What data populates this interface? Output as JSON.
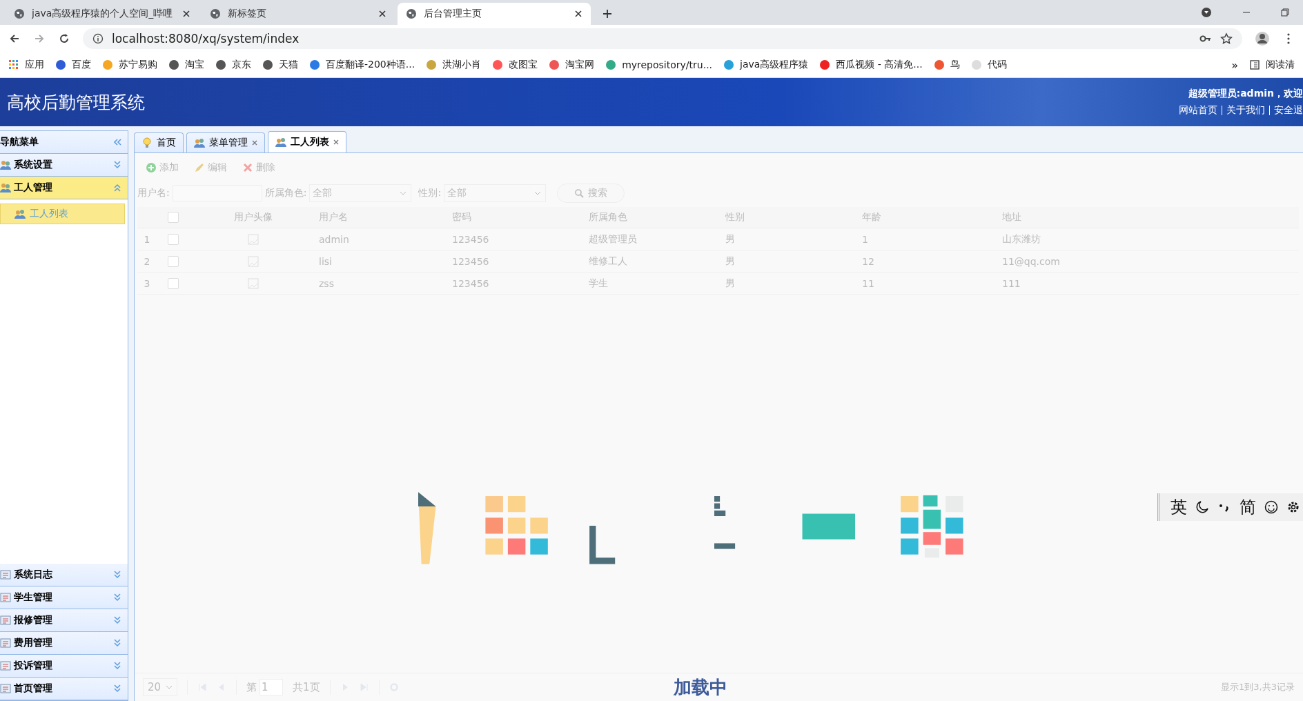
{
  "browser": {
    "tabs": [
      {
        "title": "java高级程序猿的个人空间_哔哩",
        "selected": false
      },
      {
        "title": "新标签页",
        "selected": false
      },
      {
        "title": "后台管理主页",
        "selected": true
      }
    ],
    "url": "localhost:8080/xq/system/index",
    "bookmarks": [
      {
        "label": "应用"
      },
      {
        "label": "百度"
      },
      {
        "label": "苏宁易购"
      },
      {
        "label": "淘宝"
      },
      {
        "label": "京东"
      },
      {
        "label": "天猫"
      },
      {
        "label": "百度翻译-200种语..."
      },
      {
        "label": "洪湖小肖"
      },
      {
        "label": "改图宝"
      },
      {
        "label": "淘宝网"
      },
      {
        "label": "myrepository/tru..."
      },
      {
        "label": "java高级程序猿"
      },
      {
        "label": "西瓜视频 - 高清免..."
      },
      {
        "label": "鸟"
      },
      {
        "label": "代码"
      }
    ],
    "overflow": "»",
    "reading_list": "阅读清"
  },
  "header": {
    "title": "高校后勤管理系统",
    "greeting": "超级管理员:admin，欢迎",
    "links": [
      "网站首页",
      "关于我们",
      "安全退"
    ]
  },
  "sidebar": {
    "title": "导航菜单",
    "sections": [
      {
        "label": "系统设置",
        "expanded": false
      },
      {
        "label": "工人管理",
        "expanded": true,
        "children": [
          {
            "label": "工人列表",
            "selected": true
          }
        ]
      }
    ],
    "bottom_sections": [
      {
        "label": "系统日志",
        "expanded": false
      },
      {
        "label": "学生管理",
        "expanded": false
      },
      {
        "label": "报修管理",
        "expanded": false
      },
      {
        "label": "费用管理",
        "expanded": false
      },
      {
        "label": "投诉管理",
        "expanded": false
      },
      {
        "label": "首页管理",
        "expanded": false
      }
    ]
  },
  "tabs": [
    {
      "label": "首页",
      "selected": false,
      "closable": false
    },
    {
      "label": "菜单管理",
      "selected": false,
      "closable": true
    },
    {
      "label": "工人列表",
      "selected": true,
      "closable": true
    }
  ],
  "toolbar": [
    {
      "label": "添加",
      "kind": "add"
    },
    {
      "label": "编辑",
      "kind": "edit"
    },
    {
      "label": "删除",
      "kind": "delete"
    }
  ],
  "filters": {
    "username_label": "用户名:",
    "role_label": "所属角色:",
    "role_value": "全部",
    "gender_label": "性别:",
    "gender_value": "全部",
    "search": "搜索"
  },
  "table": {
    "header_checked": false,
    "columns": [
      "用户头像",
      "用户名",
      "密码",
      "所属角色",
      "性别",
      "年龄",
      "地址"
    ],
    "rows": [
      {
        "index": "1",
        "checked": false,
        "cells": [
          "",
          "admin",
          "123456",
          "超级管理员",
          "男",
          "1",
          "山东潍坊"
        ]
      },
      {
        "index": "2",
        "checked": false,
        "cells": [
          "",
          "lisi",
          "123456",
          "维修工人",
          "男",
          "12",
          "11@qq.com"
        ]
      },
      {
        "index": "3",
        "checked": false,
        "cells": [
          "",
          "zss",
          "123456",
          "学生",
          "男",
          "11",
          "111"
        ]
      }
    ]
  },
  "pager": {
    "page_size": "20",
    "page_prefix": "第",
    "page": "1",
    "page_total": "共1页",
    "info": "显示1到3,共3记录"
  },
  "loading": {
    "text": "加载中"
  },
  "ime": {
    "language": "英",
    "script": "简"
  }
}
